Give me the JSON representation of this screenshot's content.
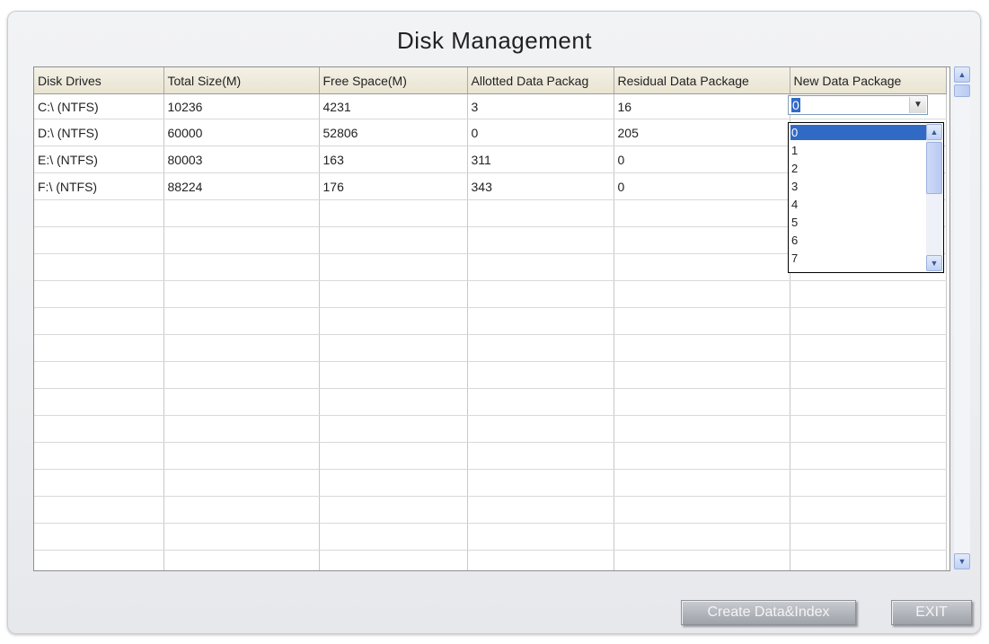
{
  "window": {
    "title": "Disk Management"
  },
  "table": {
    "columns": [
      "Disk Drives",
      "Total Size(M)",
      "Free Space(M)",
      "Allotted Data Packag",
      "Residual Data Package",
      "New Data Package"
    ],
    "rows": [
      [
        "C:\\  (NTFS)",
        "10236",
        "4231",
        "3",
        "16",
        ""
      ],
      [
        "D:\\  (NTFS)",
        "60000",
        "52806",
        "0",
        "205",
        ""
      ],
      [
        "E:\\  (NTFS)",
        "80003",
        "163",
        "311",
        "0",
        ""
      ],
      [
        "F:\\  (NTFS)",
        "88224",
        "176",
        "343",
        "0",
        ""
      ]
    ],
    "empty_row_count": 14
  },
  "combo": {
    "selected_value": "0",
    "options": [
      "0",
      "1",
      "2",
      "3",
      "4",
      "5",
      "6",
      "7"
    ]
  },
  "buttons": {
    "create_label": "Create Data&Index",
    "exit_label": "EXIT"
  },
  "colors": {
    "selection": "#316ac5",
    "header_bg": "#ece8d9",
    "button_face": "#b3b6bc"
  },
  "icons": {
    "combo_arrow": "chevron-down-icon",
    "scroll_up": "scroll-up-arrow-icon",
    "scroll_down": "scroll-down-arrow-icon"
  }
}
